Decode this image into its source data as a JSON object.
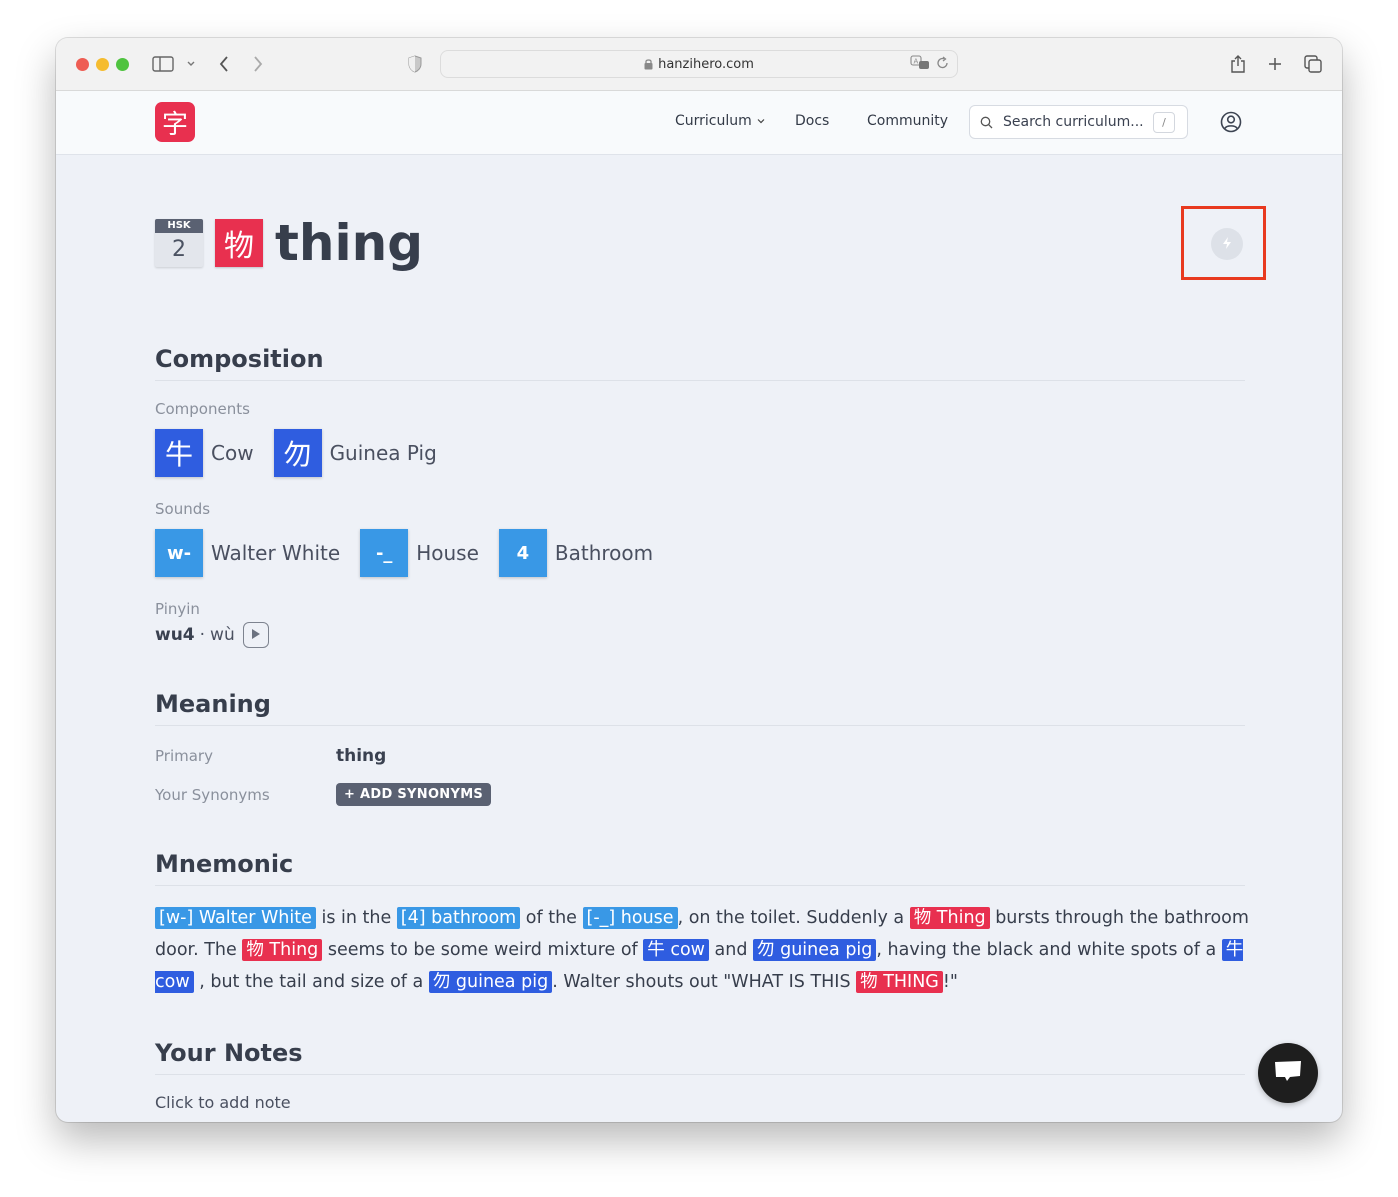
{
  "browser": {
    "url": "hanzihero.com"
  },
  "site": {
    "logo_char": "字",
    "nav": {
      "curriculum": "Curriculum",
      "docs": "Docs",
      "community": "Community"
    },
    "search": {
      "placeholder": "Search curriculum...",
      "shortcut": "/"
    }
  },
  "page": {
    "hsk_label": "HSK",
    "hsk_level": "2",
    "character": "物",
    "title": "thing",
    "sections": {
      "composition": "Composition",
      "meaning": "Meaning",
      "mnemonic": "Mnemonic",
      "notes": "Your Notes"
    },
    "components_label": "Components",
    "components": [
      {
        "char": "牛",
        "name": "Cow"
      },
      {
        "char": "勿",
        "name": "Guinea Pig"
      }
    ],
    "sounds_label": "Sounds",
    "sounds": [
      {
        "code": "w-",
        "name": "Walter White"
      },
      {
        "code": "-_",
        "name": "House"
      },
      {
        "code": "4",
        "name": "Bathroom"
      }
    ],
    "pinyin_label": "Pinyin",
    "pinyin_numeric": "wu4",
    "pinyin_separator": "·",
    "pinyin_tone": "wù",
    "meaning": {
      "primary_label": "Primary",
      "primary_value": "thing",
      "synonyms_label": "Your Synonyms",
      "add_synonyms": "+ ADD SYNONYMS"
    },
    "mnemonic": [
      {
        "type": "sound",
        "text": "[w-] Walter White"
      },
      {
        "type": "text",
        "text": " is in the "
      },
      {
        "type": "sound",
        "text": "[4] bathroom"
      },
      {
        "type": "text",
        "text": " of the "
      },
      {
        "type": "sound",
        "text": "[-_] house"
      },
      {
        "type": "text",
        "text": ", on the toilet. Suddenly a "
      },
      {
        "type": "char",
        "text": "物 Thing"
      },
      {
        "type": "text",
        "text": " bursts through the bathroom door. The "
      },
      {
        "type": "char",
        "text": "物 Thing"
      },
      {
        "type": "text",
        "text": " seems to be some weird mixture of "
      },
      {
        "type": "comp",
        "text": "牛 cow"
      },
      {
        "type": "text",
        "text": " and "
      },
      {
        "type": "comp",
        "text": "勿 guinea pig"
      },
      {
        "type": "text",
        "text": ", having the black and white spots of a "
      },
      {
        "type": "comp",
        "text": "牛 cow"
      },
      {
        "type": "text",
        "text": " , but the tail and size of a "
      },
      {
        "type": "comp",
        "text": "勿 guinea pig"
      },
      {
        "type": "text",
        "text": ". Walter shouts out \"WHAT IS THIS "
      },
      {
        "type": "char",
        "text": "物 THING"
      },
      {
        "type": "text",
        "text": "!\""
      }
    ],
    "notes_placeholder": "Click to add note"
  },
  "colors": {
    "brand_red": "#e8304f",
    "component_blue": "#2f5de0",
    "sound_blue": "#3998e6",
    "highlight_box": "#e8391f"
  }
}
